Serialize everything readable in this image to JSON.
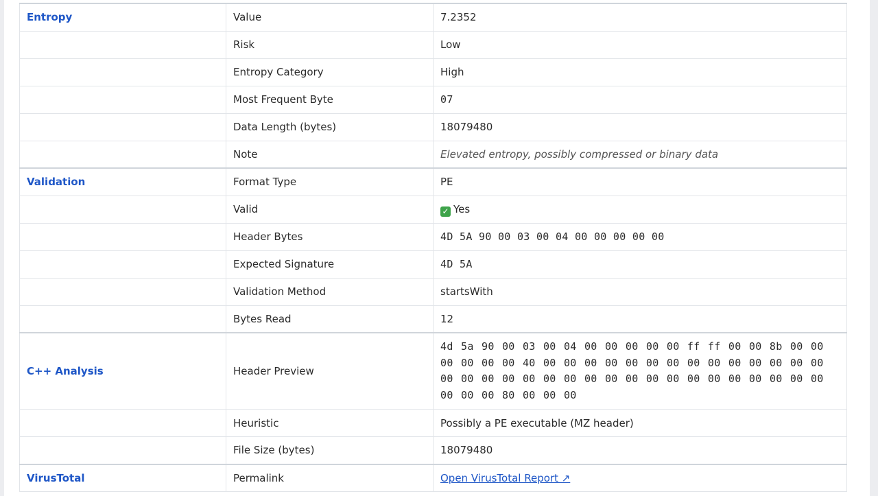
{
  "sections": {
    "entropy": {
      "title": "Entropy",
      "rows": [
        {
          "label": "Value",
          "value": "7.2352"
        },
        {
          "label": "Risk",
          "value": "Low"
        },
        {
          "label": "Entropy Category",
          "value": "High"
        },
        {
          "label": "Most Frequent Byte",
          "value": "07"
        },
        {
          "label": "Data Length (bytes)",
          "value": "18079480"
        },
        {
          "label": "Note",
          "value": "Elevated entropy, possibly compressed or binary data"
        }
      ]
    },
    "validation": {
      "title": "Validation",
      "rows": [
        {
          "label": "Format Type",
          "value": "PE"
        },
        {
          "label": "Valid",
          "icon": "check-icon",
          "value": "Yes"
        },
        {
          "label": "Header Bytes",
          "value": "4D 5A 90 00 03 00 04 00 00 00 00 00"
        },
        {
          "label": "Expected Signature",
          "value": "4D 5A"
        },
        {
          "label": "Validation Method",
          "value": "startsWith"
        },
        {
          "label": "Bytes Read",
          "value": "12"
        }
      ]
    },
    "cpp": {
      "title": "C++ Analysis",
      "rows": [
        {
          "label": "Header Preview",
          "value": "4d 5a 90 00 03 00 04 00 00 00 00 00 ff ff 00 00 8b 00 00 00 00 00 00 40 00 00 00 00 00 00 00 00 00 00 00 00 00 00 00 00 00 00 00 00 00 00 00 00 00 00 00 00 00 00 00 00 00 00 00 00 80 00 00 00"
        },
        {
          "label": "Heuristic",
          "value": "Possibly a PE executable (MZ header)"
        },
        {
          "label": "File Size (bytes)",
          "value": "18079480"
        }
      ]
    },
    "virustotal": {
      "title": "VirusTotal",
      "rows": [
        {
          "label": "Permalink",
          "value": "Open VirusTotal Report ↗"
        }
      ]
    }
  },
  "colors": {
    "section_title": "#1f57c7",
    "link": "#1f57c7",
    "check_green": "#3ea34a"
  }
}
